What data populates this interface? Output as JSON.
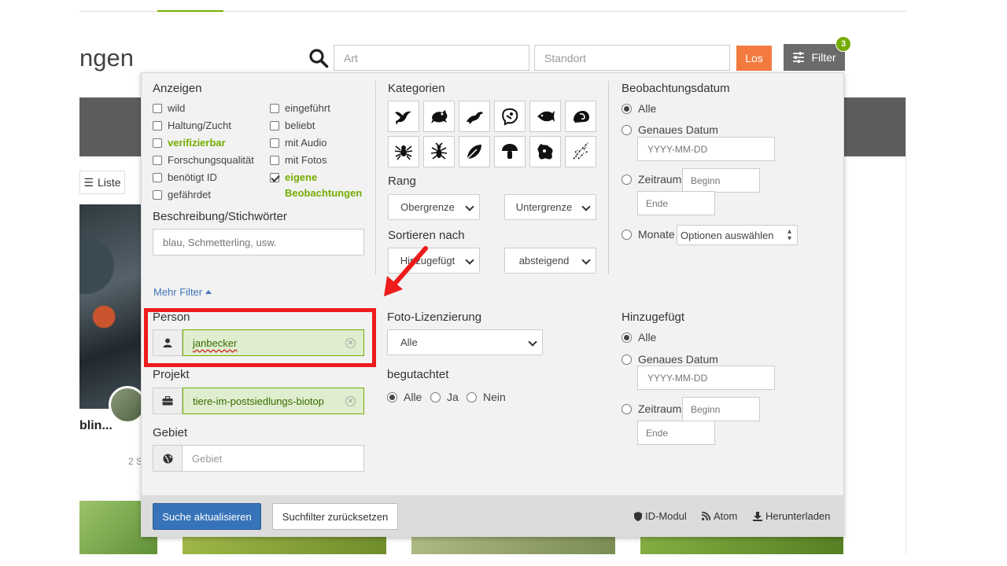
{
  "page": {
    "heading": "ngen",
    "search_art_placeholder": "Art",
    "search_standort_placeholder": "Standort",
    "los_label": "Los",
    "filter_label": "Filter",
    "filter_count": "3",
    "liste_label": "Liste",
    "obs_title": "blin...",
    "obs_sub": "2 S"
  },
  "panel": {
    "anzeigen": {
      "title": "Anzeigen",
      "col1": [
        {
          "label": "wild",
          "checked": false,
          "highlight": false
        },
        {
          "label": "Haltung/Zucht",
          "checked": false,
          "highlight": false
        },
        {
          "label": "verifizierbar",
          "checked": false,
          "highlight": true
        },
        {
          "label": "Forschungsqualität",
          "checked": false,
          "highlight": false
        },
        {
          "label": "benötigt ID",
          "checked": false,
          "highlight": false
        },
        {
          "label": "gefährdet",
          "checked": false,
          "highlight": false
        }
      ],
      "col2": [
        {
          "label": "eingeführt",
          "checked": false,
          "highlight": false
        },
        {
          "label": "beliebt",
          "checked": false,
          "highlight": false
        },
        {
          "label": "mit Audio",
          "checked": false,
          "highlight": false
        },
        {
          "label": "mit Fotos",
          "checked": false,
          "highlight": false
        },
        {
          "label": "eigene Beobachtungen",
          "checked": true,
          "highlight": true
        }
      ]
    },
    "beschreibung": {
      "title": "Beschreibung/Stichwörter",
      "placeholder": "blau, Schmetterling, usw."
    },
    "mehr_filter": "Mehr Filter",
    "kategorien": {
      "title": "Kategorien",
      "icons": [
        "bird-icon",
        "amphibian-icon",
        "reptile-icon",
        "mammal-icon",
        "fish-icon",
        "mollusk-icon",
        "arachnid-icon",
        "insect-icon",
        "plant-icon",
        "fungi-icon",
        "protozoa-icon",
        "unknown-icon"
      ]
    },
    "rang": {
      "title": "Rang",
      "upper": "Obergrenze",
      "lower": "Untergrenze"
    },
    "sortieren": {
      "title": "Sortieren nach",
      "by": "Hinzugefügt",
      "order": "absteigend"
    },
    "beobachtungsdatum": {
      "title": "Beobachtungsdatum",
      "alle": "Alle",
      "genaues_datum": "Genaues Datum",
      "date_placeholder": "YYYY-MM-DD",
      "zeitraum": "Zeitraum",
      "beginn": "Beginn",
      "ende": "Ende",
      "monate": "Monate",
      "monate_select": "Optionen auswählen"
    },
    "person": {
      "title": "Person",
      "value": "janbecker"
    },
    "projekt": {
      "title": "Projekt",
      "value": "tiere-im-postsiedlungs-biotop"
    },
    "gebiet": {
      "title": "Gebiet",
      "placeholder": "Gebiet"
    },
    "foto_lizenz": {
      "title": "Foto-Lizenzierung",
      "value": "Alle"
    },
    "begutachtet": {
      "title": "begutachtet",
      "options": [
        "Alle",
        "Ja",
        "Nein"
      ]
    },
    "hinzugefuegt": {
      "title": "Hinzugefügt",
      "alle": "Alle",
      "genaues_datum": "Genaues Datum",
      "date_placeholder": "YYYY-MM-DD",
      "zeitraum": "Zeitraum",
      "beginn": "Beginn",
      "ende": "Ende"
    },
    "footer": {
      "update": "Suche aktualisieren",
      "reset": "Suchfilter zurücksetzen",
      "id_modul": "ID-Modul",
      "atom": "Atom",
      "download": "Herunterladen"
    }
  },
  "colors": {
    "accent_green": "#74ac00",
    "orange": "#f27a3f",
    "primary_blue": "#3773b8",
    "annotation_red": "#ee1c1c"
  }
}
